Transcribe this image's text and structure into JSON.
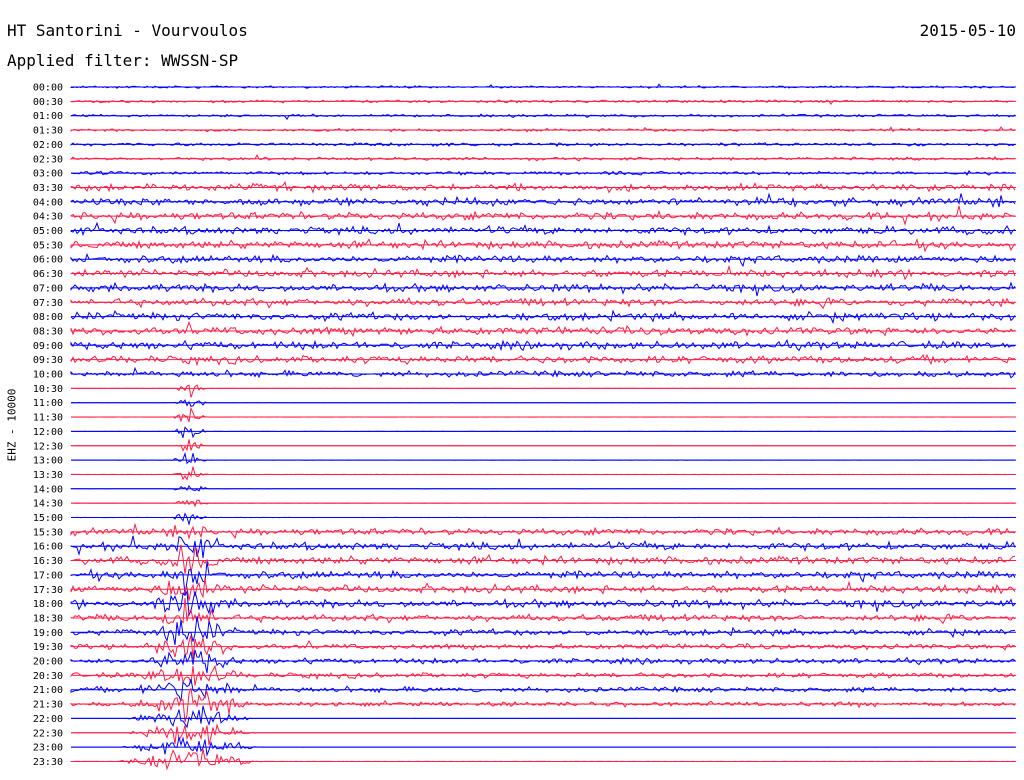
{
  "header": {
    "title": "HT Santorini - Vourvoulos",
    "date": "2015-05-10",
    "filter": "Applied filter: WWSSN-SP"
  },
  "colors": {
    "trace_a": "#0000ff",
    "trace_b": "#ff1e46",
    "background": "#ffffff"
  },
  "chart_data": {
    "type": "line",
    "chart_kind": "helicorder",
    "ylabel": "EHZ - 10000",
    "row_labels": [
      "00:00",
      "00:30",
      "01:00",
      "01:30",
      "02:00",
      "02:30",
      "03:00",
      "03:30",
      "04:00",
      "04:30",
      "05:00",
      "05:30",
      "06:00",
      "06:30",
      "07:00",
      "07:30",
      "08:00",
      "08:30",
      "09:00",
      "09:30",
      "10:00",
      "10:30",
      "11:00",
      "11:30",
      "12:00",
      "12:30",
      "13:00",
      "13:30",
      "14:00",
      "14:30",
      "15:00",
      "15:30",
      "16:00",
      "16:30",
      "17:00",
      "17:30",
      "18:00",
      "18:30",
      "19:00",
      "19:30",
      "20:00",
      "20:30",
      "21:00",
      "21:30",
      "22:00",
      "22:30",
      "23:00",
      "23:30"
    ],
    "series": [
      {
        "color": "#0000ff",
        "rows": "even"
      },
      {
        "color": "#ff1e46",
        "rows": "odd"
      }
    ],
    "row_noise_level": [
      0.25,
      0.3,
      0.3,
      0.3,
      0.35,
      0.35,
      0.4,
      0.8,
      0.9,
      0.9,
      0.9,
      0.9,
      0.9,
      0.9,
      0.9,
      0.9,
      0.9,
      0.9,
      0.9,
      0.9,
      0.7,
      0.02,
      0.02,
      0.02,
      0.02,
      0.02,
      0.02,
      0.02,
      0.02,
      0.02,
      0.02,
      0.8,
      0.9,
      0.9,
      0.9,
      0.9,
      0.9,
      0.8,
      0.7,
      0.6,
      0.6,
      0.6,
      0.6,
      0.5,
      0.01,
      0.01,
      0.01,
      0.01
    ],
    "notable_events": [
      {
        "start": "10:30",
        "end": "23:30",
        "description": "large event"
      }
    ],
    "grid": false
  }
}
